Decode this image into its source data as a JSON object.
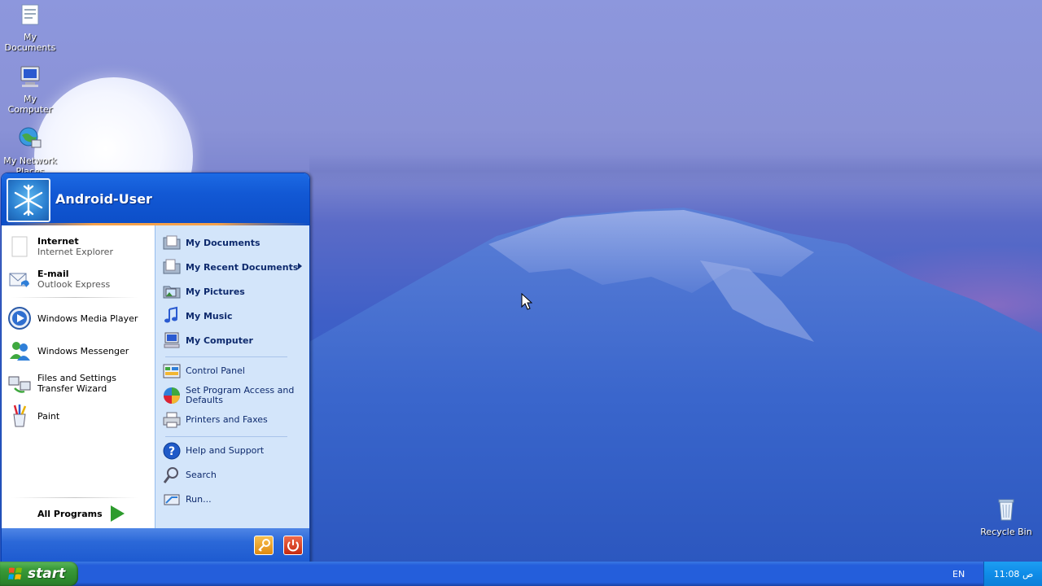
{
  "desktop": {
    "icons": [
      {
        "label": "My Documents"
      },
      {
        "label": "My Computer"
      },
      {
        "label": "My Network Places"
      },
      {
        "label": "Recycle Bin"
      }
    ]
  },
  "start_menu": {
    "user_name": "Android-User",
    "left": {
      "pinned": [
        {
          "title": "Internet",
          "subtitle": "Internet Explorer"
        },
        {
          "title": "E-mail",
          "subtitle": "Outlook Express"
        }
      ],
      "recent": [
        {
          "label": "Windows Media Player"
        },
        {
          "label": "Windows Messenger"
        },
        {
          "label": "Files and Settings Transfer Wizard"
        },
        {
          "label": "Paint"
        }
      ],
      "all_programs": "All Programs"
    },
    "right": {
      "places": [
        {
          "label": "My Documents"
        },
        {
          "label": "My Recent Documents"
        },
        {
          "label": "My Pictures"
        },
        {
          "label": "My Music"
        },
        {
          "label": "My Computer"
        }
      ],
      "settings": [
        {
          "label": "Control Panel"
        },
        {
          "label": "Set Program Access and Defaults"
        },
        {
          "label": "Printers and Faxes"
        }
      ],
      "tools": [
        {
          "label": "Help and Support"
        },
        {
          "label": "Search"
        },
        {
          "label": "Run..."
        }
      ]
    }
  },
  "taskbar": {
    "start_label": "start",
    "language": "EN",
    "clock": "11:08 ص"
  },
  "colors": {
    "taskbar_blue": "#245edb",
    "start_green": "#3a9a3a",
    "menu_header_blue": "#1258d4",
    "right_pane": "#d3e5fa"
  }
}
